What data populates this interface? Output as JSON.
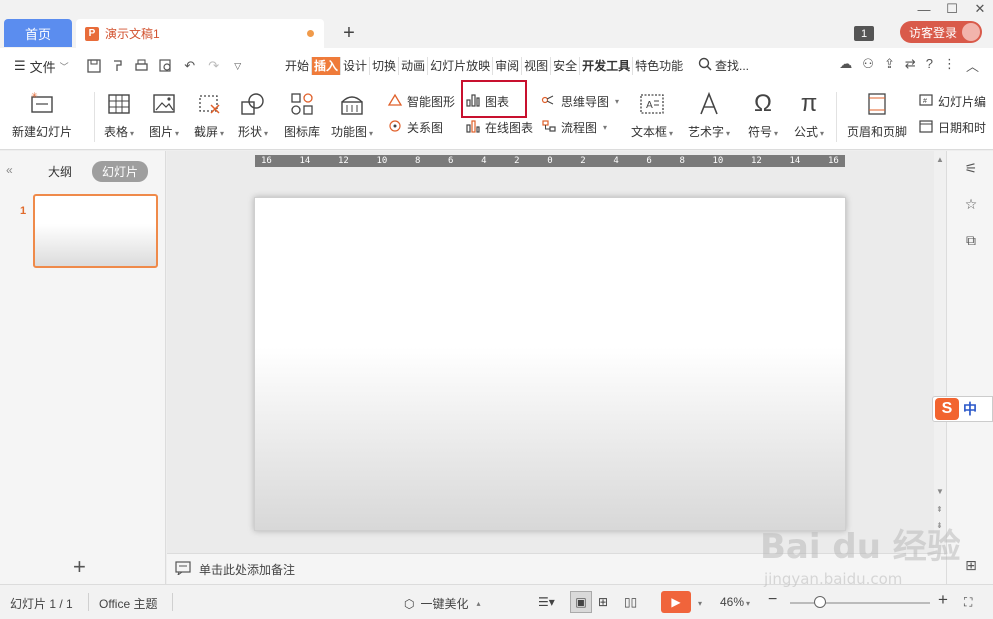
{
  "tabs": {
    "home": "首页",
    "doc": "演示文稿1",
    "add": "+"
  },
  "window": {
    "min": "—",
    "max": "☐",
    "close": "✕"
  },
  "account": {
    "badge": "1",
    "login": "访客登录"
  },
  "menu": {
    "file": "文件",
    "tabs": [
      "开始",
      "插入",
      "设计",
      "切换",
      "动画",
      "幻灯片放映",
      "审阅",
      "视图",
      "安全",
      "开发工具",
      "特色功能"
    ],
    "active_tab": "插入",
    "search": "查找..."
  },
  "ribbon": {
    "new_slide": "新建幻灯片",
    "table": "表格",
    "picture": "图片",
    "screenshot": "截屏",
    "shape": "形状",
    "icon_lib": "图标库",
    "func_chart": "功能图",
    "smart_graphic": "智能图形",
    "chart": "图表",
    "mind_map": "思维导图",
    "relation": "关系图",
    "online_chart": "在线图表",
    "flowchart": "流程图",
    "textbox": "文本框",
    "wordart": "艺术字",
    "symbol": "符号",
    "formula": "公式",
    "header_footer": "页眉和页脚",
    "slide_number": "幻灯片编",
    "date_time": "日期和时"
  },
  "left_panel": {
    "outline": "大纲",
    "slides": "幻灯片",
    "slide_number": "1",
    "add": "+"
  },
  "ruler": {
    "ticks": [
      "16",
      "14",
      "12",
      "10",
      "8",
      "6",
      "4",
      "2",
      "0",
      "2",
      "4",
      "6",
      "8",
      "10",
      "12",
      "14",
      "16"
    ]
  },
  "notes": {
    "placeholder": "单击此处添加备注"
  },
  "ime": {
    "logo": "S",
    "lang": "中"
  },
  "status": {
    "slide_count": "幻灯片 1 / 1",
    "theme": "Office 主题",
    "beautify": "一键美化",
    "zoom": "46%"
  },
  "watermark": {
    "brand": "Bai du 经验",
    "url": "jingyan.baidu.com"
  },
  "colors": {
    "accent": "#ef7b3a",
    "home_tab": "#5b8def",
    "login": "#d95a4a",
    "highlight": "#c8102e",
    "play": "#f0643b"
  }
}
